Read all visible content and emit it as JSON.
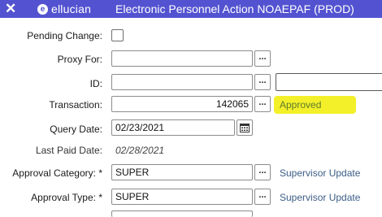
{
  "header": {
    "close_glyph": "✕",
    "logo_letter": "e",
    "logo_text": "ellucian",
    "title": "Electronic Personnel Action NOAEPAF (PROD)",
    "bar_color": "#5353d1"
  },
  "form": {
    "pending_change": {
      "label": "Pending Change:",
      "checked": false
    },
    "proxy_for": {
      "label": "Proxy For:",
      "value": ""
    },
    "id": {
      "label": "ID:",
      "value": "",
      "name_value": ""
    },
    "transaction": {
      "label": "Transaction:",
      "value": "142065",
      "status": "Approved",
      "status_highlight": "#f3f02a"
    },
    "query_date": {
      "label": "Query Date:",
      "value": "02/23/2021"
    },
    "last_paid_date": {
      "label": "Last Paid Date:",
      "value": "02/28/2021"
    },
    "approval_category": {
      "label": "Approval Category: *",
      "value": "SUPER",
      "description": "Supervisor Update"
    },
    "approval_type": {
      "label": "Approval Type: *",
      "value": "SUPER",
      "description": "Supervisor Update"
    }
  },
  "icons": {
    "lookup": "lookup-ellipsis-icon",
    "calendar": "calendar-icon"
  },
  "lookup_glyph": "..."
}
